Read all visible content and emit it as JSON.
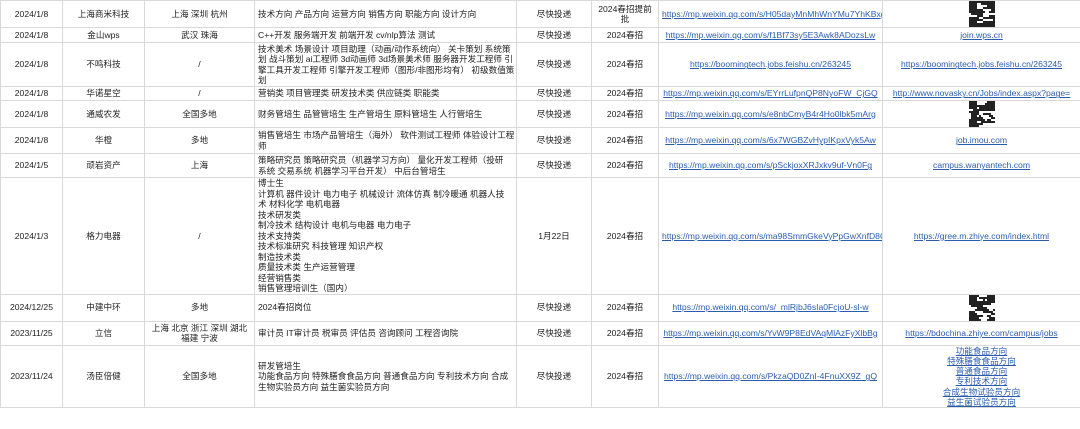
{
  "rows": [
    {
      "date": "2024/1/8",
      "company": "上海商米科技",
      "location": "上海 深圳 杭州",
      "positions": [
        "技术方向 产品方向 运营方向 销售方向 职能方向 设计方向"
      ],
      "deadline": "尽快投递",
      "type": "2024春招提前批",
      "link1": "https://mp.weixin.qq.com/s/H05dayMnMhWnYMu7YhKBxg",
      "link2_qr": true,
      "link2": ""
    },
    {
      "date": "2024/1/8",
      "company": "金山wps",
      "location": "武汉 珠海",
      "positions": [
        "C++开发 服务端开发 前端开发 cv/nlp算法 测试"
      ],
      "deadline": "尽快投递",
      "type": "2024春招",
      "link1": "https://mp.weixin.qq.com/s/f1Bf73sy5E3Awk8ADozsLw",
      "link2_qr": false,
      "link2": "join.wps.cn"
    },
    {
      "date": "2024/1/8",
      "company": "不鸣科技",
      "location": "/",
      "positions": [
        "技术美术 场景设计 项目助理（动画/动作系统向） 关卡策划 系统策",
        "划 战斗策划 ai工程师 3d动画师 3d场景美术师 服务器开发工程师 引",
        "擎工具开发工程师 引擎开发工程师（图形/非图形均有） 初级数值策",
        "划"
      ],
      "deadline": "尽快投递",
      "type": "2024春招",
      "link1": "https://boomingtech.jobs.feishu.cn/263245",
      "link2_qr": false,
      "link2": "https://boomingtech.jobs.feishu.cn/263245"
    },
    {
      "date": "2024/1/8",
      "company": "华诺星空",
      "location": "/",
      "positions": [
        "营销类 项目管理类 研发技术类 供应链类 职能类"
      ],
      "deadline": "尽快投递",
      "type": "2024春招",
      "link1": "https://mp.weixin.qq.com/s/EYrrLufpnQP8NyoFW_CjGQ",
      "link2_qr": false,
      "link2": "http://www.novasky.cn/Jobs/index.aspx?page="
    },
    {
      "date": "2024/1/8",
      "company": "通威农发",
      "location": "全国多地",
      "positions": [
        "财务管培生 品管管培生 生产管培生 原料管培生 人行管培生"
      ],
      "deadline": "尽快投递",
      "type": "2024春招",
      "link1": "https://mp.weixin.qq.com/s/e8nbCmyB4r4Ho0lbk5mArg",
      "link2_qr": true,
      "link2": ""
    },
    {
      "date": "2024/1/8",
      "company": "华橙",
      "location": "多地",
      "positions": [
        "销售管培生 市场产品管培生（海外） 软件测试工程师 体验设计工程",
        "师"
      ],
      "deadline": "尽快投递",
      "type": "2024春招",
      "link1": "https://mp.weixin.qq.com/s/6x7WGBZvHypIKpxVyk5Aw",
      "link2_qr": false,
      "link2": "job.imou.com"
    },
    {
      "date": "2024/1/5",
      "company": "顽岩资产",
      "location": "上海",
      "positions": [
        "策略研究员 策略研究员（机器学习方向） 量化开发工程师（投研",
        "系统 交易系统 机器学习平台开发） 中后台管培生"
      ],
      "deadline": "尽快投递",
      "type": "2024春招",
      "link1": "https://mp.weixin.qq.com/s/pSckjoxXRJxkv9uf-Vn0Fg",
      "link2_qr": false,
      "link2": "campus.wanyantech.com"
    },
    {
      "date": "2024/1/3",
      "company": "格力电器",
      "location": "/",
      "positions": [
        "博士生",
        "计算机 器件设计 电力电子 机械设计 流体仿真 制冷暖通 机器人技",
        "术 材料化学 电机电器",
        "技术研发类",
        "制冷技术 结构设计 电机与电器 电力电子",
        "技术支持类",
        "技术标准研究 科技管理 知识产权",
        "制造技术类",
        "质量技术类 生产运营管理",
        "经营销售类",
        "销售管理培训生（国内）"
      ],
      "deadline": "1月22日",
      "type": "2024春招",
      "link1": "https://mp.weixin.qq.com/s/ma98SmmGkeVyPpGwXnfD8Q",
      "link2_qr": false,
      "link2": "https://gree.m.zhiye.com/index.html"
    },
    {
      "date": "2024/12/25",
      "company": "中建中环",
      "location": "多地",
      "positions": [
        "2024春招岗位"
      ],
      "deadline": "尽快投递",
      "type": "2024春招",
      "link1": "https://mp.weixin.qq.com/s/_mlRjbJ6sIa0FcjoU-sl-w",
      "link2_qr": true,
      "link2": ""
    },
    {
      "date": "2023/11/25",
      "company": "立信",
      "location": "上海 北京 浙江 深圳 湖北 福建 宁波",
      "positions": [
        "审计员 IT审计员 税审员 评估员 咨询顾问 工程咨询院"
      ],
      "deadline": "尽快投递",
      "type": "2024春招",
      "link1": "https://mp.weixin.qq.com/s/YvW9P8EdVAqMlAzFyXlbBg",
      "link2_qr": false,
      "link2": "https://bdochina.zhiye.com/campus/jobs"
    },
    {
      "date": "2023/11/24",
      "company": "汤臣倍健",
      "location": "全国多地",
      "positions": [
        "研发管培生",
        "功能食品方向 特殊膳食食品方向 普通食品方向 专利技术方向 合成",
        "生物实验员方向 益生菌实验员方向"
      ],
      "deadline": "尽快投递",
      "type": "2024春招",
      "link1": "https://mp.weixin.qq.com/s/PkzaQD0ZnI-4FnuXX9Z_gQ",
      "link2_qr": false,
      "link2": "",
      "link2_list": [
        "功能食品方向",
        "特殊膳食食品方向",
        "普通食品方向",
        "专利技术方向",
        "合成生物试验员方向",
        "益生菌试验员方向"
      ]
    }
  ],
  "colors": {
    "link": "#2a5db0",
    "border": "#d9d9d9",
    "text": "#222222"
  },
  "icons": {
    "qr": "qr-code-icon"
  }
}
